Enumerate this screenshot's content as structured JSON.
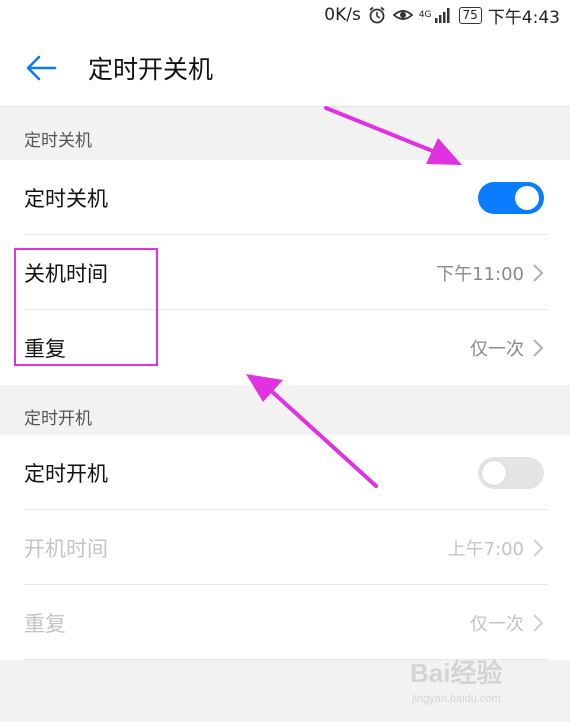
{
  "status_bar": {
    "speed": "0K/s",
    "network_label": "4G",
    "battery": "75",
    "time": "下午4:43"
  },
  "header": {
    "title": "定时开关机"
  },
  "shutdown_section": {
    "header": "定时关机",
    "toggle_label": "定时关机",
    "toggle_on": true,
    "time_label": "关机时间",
    "time_value": "下午11:00",
    "repeat_label": "重复",
    "repeat_value": "仅一次"
  },
  "startup_section": {
    "header": "定时开机",
    "toggle_label": "定时开机",
    "toggle_on": false,
    "time_label": "开机时间",
    "time_value": "上午7:00",
    "repeat_label": "重复",
    "repeat_value": "仅一次"
  },
  "colors": {
    "accent": "#0a7cff",
    "annotation": "#e032e0"
  },
  "watermark": {
    "text": "Bai经验",
    "url": "jingyan.baidu.com"
  }
}
